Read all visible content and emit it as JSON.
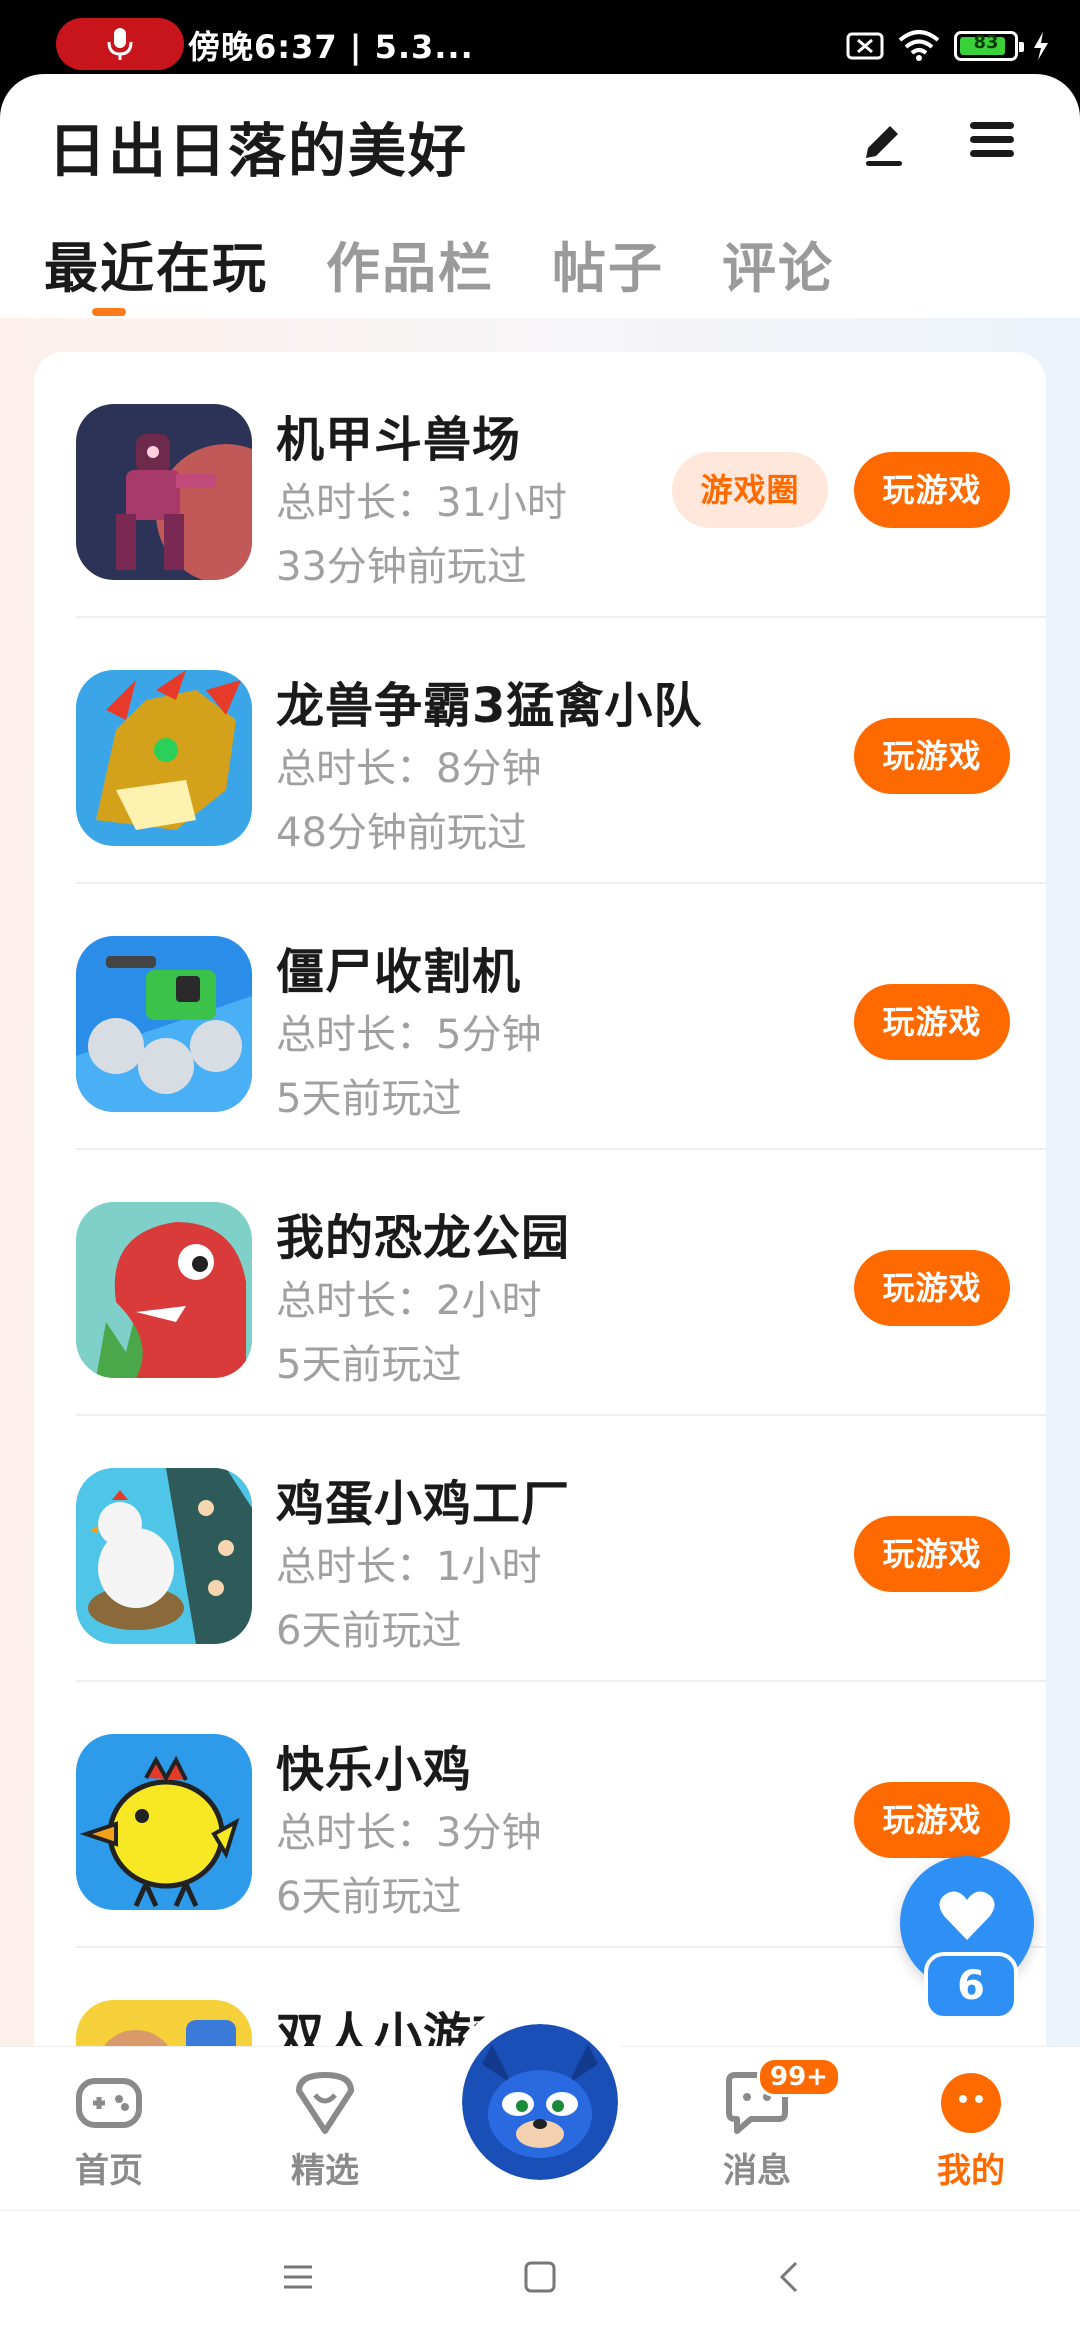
{
  "status_bar": {
    "text": "傍晚6:37 | 5.3...",
    "battery": "83",
    "colors": {
      "mic_pill": "#c8151b",
      "battery_fill": "#3ad13a"
    }
  },
  "header": {
    "title": "日出日落的美好",
    "edit_icon": "edit-icon",
    "menu_icon": "menu-icon"
  },
  "tabs": [
    {
      "label": "最近在玩",
      "active": true
    },
    {
      "label": "作品栏",
      "active": false
    },
    {
      "label": "帖子",
      "active": false
    },
    {
      "label": "评论",
      "active": false
    }
  ],
  "games": [
    {
      "name": "机甲斗兽场",
      "duration": "总时长：31小时",
      "last_played": "33分钟前玩过",
      "circle_label": "游戏圈",
      "play_label": "玩游戏"
    },
    {
      "name": "龙兽争霸3猛禽小队",
      "duration": "总时长：8分钟",
      "last_played": "48分钟前玩过",
      "play_label": "玩游戏"
    },
    {
      "name": "僵尸收割机",
      "duration": "总时长：5分钟",
      "last_played": "5天前玩过",
      "play_label": "玩游戏"
    },
    {
      "name": "我的恐龙公园",
      "duration": "总时长：2小时",
      "last_played": "5天前玩过",
      "play_label": "玩游戏"
    },
    {
      "name": "鸡蛋小鸡工厂",
      "duration": "总时长：1小时",
      "last_played": "6天前玩过",
      "play_label": "玩游戏"
    },
    {
      "name": "快乐小鸡",
      "duration": "总时长：3分钟",
      "last_played": "6天前玩过",
      "play_label": "玩游戏"
    },
    {
      "name": "双人小游戏",
      "duration": "",
      "last_played": "",
      "play_label": ""
    }
  ],
  "floating_like": {
    "count": "6",
    "icon": "heart-icon"
  },
  "bottom_nav": [
    {
      "label": "首页",
      "icon": "gamepad-icon",
      "active": false
    },
    {
      "label": "精选",
      "icon": "heart-badge-icon",
      "active": false
    },
    {
      "label": "",
      "icon": "avatar-center",
      "active": false
    },
    {
      "label": "消息",
      "icon": "chat-icon",
      "active": false,
      "badge": "99+"
    },
    {
      "label": "我的",
      "icon": "profile-icon",
      "active": true
    }
  ],
  "system_nav": {
    "recents": "menu-lines-icon",
    "home": "square-icon",
    "back": "back-chevron-icon"
  },
  "colors": {
    "accent": "#ff6a00",
    "accent_light": "#ffe8db",
    "like_blue": "#2e8ff5",
    "muted_text": "#a0a0a0"
  }
}
